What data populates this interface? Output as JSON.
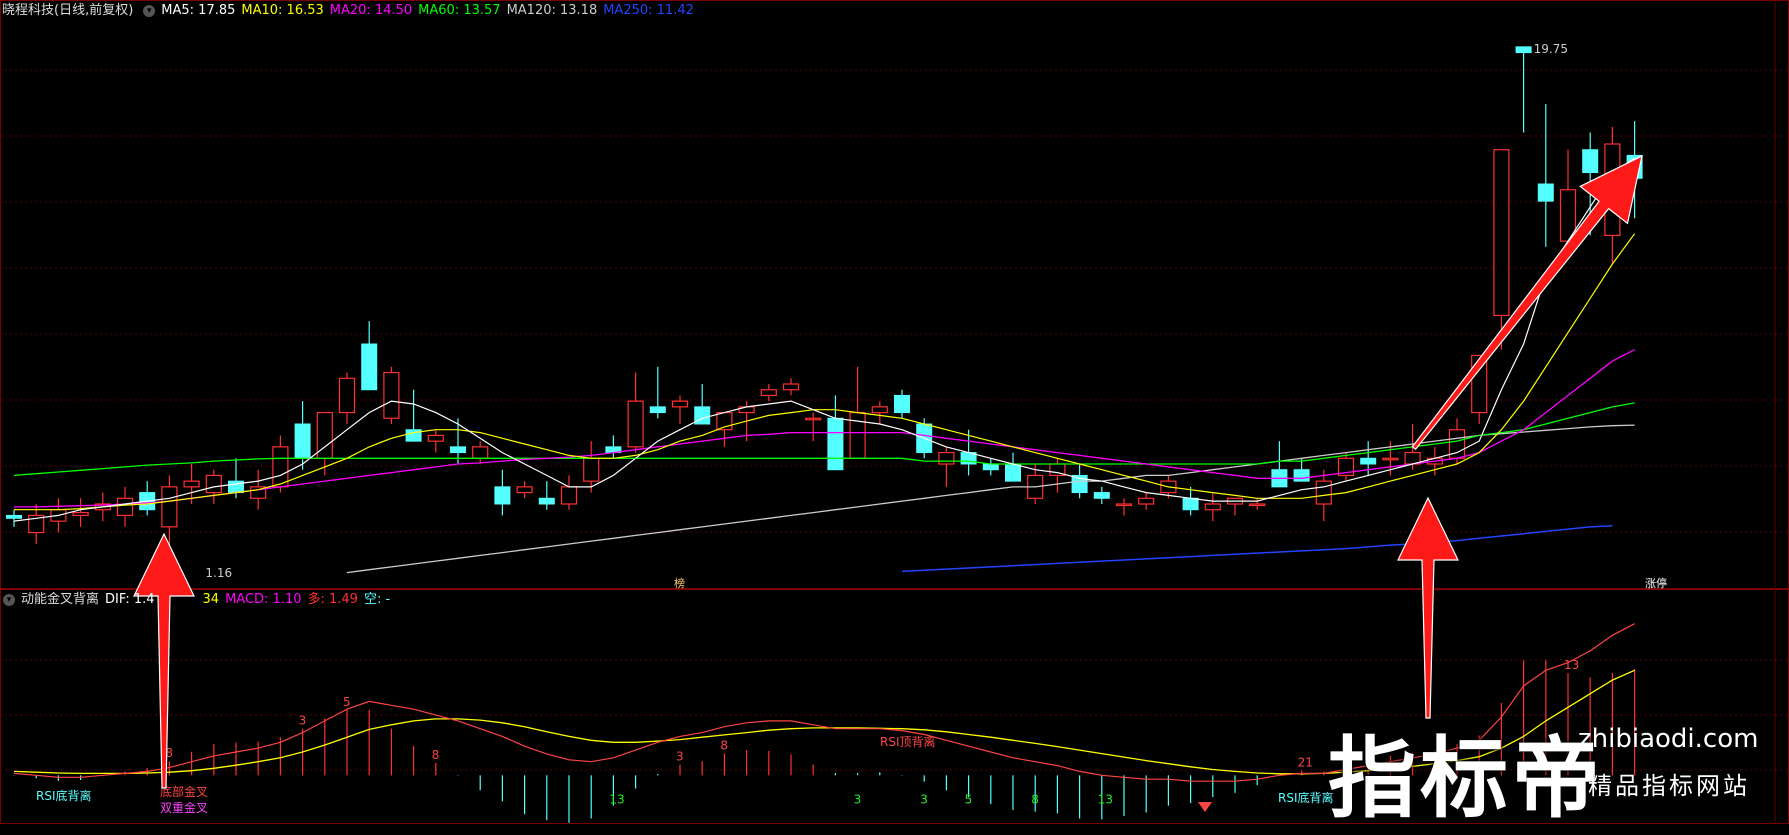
{
  "header": {
    "stock": "晓程科技(日线,前复权)",
    "ma5": "MA5: 17.85",
    "ma10": "MA10: 16.53",
    "ma20": "MA20: 14.50",
    "ma60": "MA60: 13.57",
    "ma120": "MA120: 13.18",
    "ma250": "MA250: 11.42"
  },
  "sub_header": {
    "name": "动能金叉背离",
    "dif": "DIF: 1.4",
    "dea_fragment": "34",
    "macd": "MACD: 1.10",
    "duo": "多: 1.49",
    "kong": "空: -"
  },
  "price_labels": {
    "high": "19.75",
    "low": "1.16"
  },
  "markers": {
    "bang": "榜",
    "zhangting": "涨停"
  },
  "sub_labels": {
    "rsi_bottom_1": "RSI底背离",
    "dibu_jincha": "底部金叉",
    "shuangchong_jincha": "双重金叉",
    "rsi_top": "RSI顶背离",
    "rsi_bottom_2": "RSI底背离"
  },
  "watermark": {
    "big": "指标帝",
    "url": "zhibiaodi.com",
    "sub": "精品指标网站"
  },
  "colors": {
    "ma5": "#ffffff",
    "ma10": "#ffff00",
    "ma20": "#ff00ff",
    "ma60": "#00ff00",
    "ma120": "#cccccc",
    "ma250": "#2244ff",
    "up": "#ff3030",
    "down": "#54ffff",
    "arrow": "#ff1a1a",
    "grid": "#5a0000"
  },
  "chart_data": {
    "type": "candlestick",
    "ylim": [
      10.4,
      20.2
    ],
    "ohlc": [
      [
        11.6,
        11.7,
        11.4,
        11.55
      ],
      [
        11.3,
        11.8,
        11.1,
        11.6
      ],
      [
        11.5,
        11.9,
        11.3,
        11.7
      ],
      [
        11.6,
        11.9,
        11.4,
        11.65
      ],
      [
        11.7,
        12.0,
        11.5,
        11.8
      ],
      [
        11.6,
        12.1,
        11.4,
        11.9
      ],
      [
        12.0,
        12.2,
        11.6,
        11.7
      ],
      [
        11.4,
        12.3,
        10.8,
        12.1
      ],
      [
        12.1,
        12.5,
        11.8,
        12.2
      ],
      [
        12.0,
        12.4,
        11.8,
        12.3
      ],
      [
        12.2,
        12.6,
        11.9,
        12.0
      ],
      [
        11.9,
        12.4,
        11.7,
        12.1
      ],
      [
        12.1,
        13.0,
        12.0,
        12.8
      ],
      [
        13.2,
        13.6,
        12.4,
        12.6
      ],
      [
        12.6,
        13.4,
        12.3,
        13.4
      ],
      [
        13.4,
        14.1,
        13.2,
        14.0
      ],
      [
        14.6,
        15.0,
        13.8,
        13.8
      ],
      [
        13.3,
        14.2,
        13.2,
        14.1
      ],
      [
        13.1,
        13.8,
        13.0,
        12.9
      ],
      [
        12.9,
        13.1,
        12.7,
        13.0
      ],
      [
        12.8,
        13.3,
        12.5,
        12.7
      ],
      [
        12.6,
        12.9,
        12.5,
        12.8
      ],
      [
        12.1,
        12.4,
        11.6,
        11.8
      ],
      [
        12.0,
        12.2,
        11.9,
        12.1
      ],
      [
        11.9,
        12.2,
        11.7,
        11.8
      ],
      [
        11.8,
        12.3,
        11.7,
        12.1
      ],
      [
        12.2,
        12.9,
        12.0,
        12.6
      ],
      [
        12.8,
        13.0,
        12.6,
        12.7
      ],
      [
        12.8,
        14.1,
        12.7,
        13.6
      ],
      [
        13.5,
        14.2,
        13.3,
        13.4
      ],
      [
        13.5,
        13.7,
        13.2,
        13.6
      ],
      [
        13.5,
        13.9,
        13.2,
        13.2
      ],
      [
        13.1,
        13.2,
        12.8,
        13.4
      ],
      [
        13.4,
        13.6,
        12.9,
        13.5
      ],
      [
        13.7,
        13.9,
        13.6,
        13.8
      ],
      [
        13.8,
        14.0,
        13.7,
        13.9
      ],
      [
        13.3,
        13.4,
        12.9,
        13.3
      ],
      [
        13.3,
        13.7,
        12.7,
        12.4
      ],
      [
        12.6,
        14.2,
        12.6,
        13.4
      ],
      [
        13.4,
        13.6,
        13.2,
        13.5
      ],
      [
        13.7,
        13.8,
        13.3,
        13.4
      ],
      [
        13.2,
        13.3,
        12.6,
        12.7
      ],
      [
        12.5,
        12.8,
        12.1,
        12.7
      ],
      [
        12.7,
        13.1,
        12.3,
        12.5
      ],
      [
        12.5,
        12.6,
        12.3,
        12.4
      ],
      [
        12.5,
        12.7,
        12.2,
        12.2
      ],
      [
        11.9,
        12.5,
        11.8,
        12.3
      ],
      [
        12.3,
        12.6,
        12.0,
        12.5
      ],
      [
        12.3,
        12.5,
        11.9,
        12.0
      ],
      [
        12.0,
        12.1,
        11.8,
        11.9
      ],
      [
        11.8,
        11.9,
        11.6,
        11.8
      ],
      [
        11.8,
        12.0,
        11.7,
        11.9
      ],
      [
        12.0,
        12.3,
        11.9,
        12.2
      ],
      [
        11.9,
        12.1,
        11.6,
        11.7
      ],
      [
        11.7,
        12.0,
        11.5,
        11.8
      ],
      [
        11.8,
        11.9,
        11.6,
        11.9
      ],
      [
        11.8,
        11.9,
        11.7,
        11.8
      ],
      [
        12.4,
        12.9,
        12.1,
        12.1
      ],
      [
        12.4,
        12.6,
        12.2,
        12.2
      ],
      [
        11.8,
        12.4,
        11.5,
        12.2
      ],
      [
        12.3,
        12.7,
        12.2,
        12.6
      ],
      [
        12.6,
        12.9,
        12.3,
        12.5
      ],
      [
        12.6,
        12.9,
        12.3,
        12.6
      ],
      [
        12.5,
        13.2,
        12.4,
        12.7
      ],
      [
        12.5,
        12.8,
        12.3,
        12.6
      ],
      [
        12.6,
        13.3,
        12.5,
        13.1
      ],
      [
        13.4,
        13.8,
        13.2,
        14.4
      ],
      [
        15.1,
        16.2,
        14.5,
        18.0
      ],
      [
        19.8,
        19.8,
        18.3,
        19.7
      ],
      [
        17.4,
        18.8,
        16.3,
        17.1
      ],
      [
        16.4,
        18.0,
        16.1,
        17.3
      ],
      [
        18.0,
        18.3,
        16.5,
        17.6
      ],
      [
        16.5,
        18.4,
        16.0,
        18.1
      ],
      [
        17.9,
        18.5,
        16.8,
        17.5
      ]
    ],
    "ma5": [
      11.5,
      11.55,
      11.6,
      11.7,
      11.75,
      11.8,
      11.85,
      11.9,
      12.0,
      12.1,
      12.15,
      12.2,
      12.3,
      12.5,
      12.8,
      13.1,
      13.4,
      13.6,
      13.55,
      13.4,
      13.2,
      12.95,
      12.7,
      12.5,
      12.3,
      12.1,
      12.1,
      12.3,
      12.6,
      12.9,
      13.1,
      13.3,
      13.4,
      13.5,
      13.55,
      13.6,
      13.45,
      13.3,
      13.25,
      13.2,
      13.1,
      12.95,
      12.8,
      12.7,
      12.6,
      12.5,
      12.4,
      12.35,
      12.25,
      12.2,
      12.1,
      12.0,
      11.95,
      11.9,
      11.85,
      11.85,
      11.85,
      11.95,
      12.05,
      12.1,
      12.2,
      12.3,
      12.4,
      12.5,
      12.6,
      12.7,
      12.9,
      13.8,
      14.6,
      15.8,
      16.4,
      17.0,
      17.6,
      17.85
    ],
    "ma10": [
      11.7,
      11.7,
      11.7,
      11.72,
      11.75,
      11.78,
      11.8,
      11.85,
      11.9,
      11.95,
      12.0,
      12.05,
      12.15,
      12.3,
      12.45,
      12.6,
      12.8,
      12.95,
      13.05,
      13.1,
      13.1,
      13.05,
      12.95,
      12.85,
      12.75,
      12.65,
      12.6,
      12.6,
      12.65,
      12.75,
      12.9,
      13.0,
      13.15,
      13.25,
      13.35,
      13.4,
      13.45,
      13.45,
      13.4,
      13.35,
      13.3,
      13.2,
      13.1,
      13.0,
      12.9,
      12.8,
      12.7,
      12.6,
      12.5,
      12.4,
      12.3,
      12.2,
      12.1,
      12.05,
      12.0,
      11.95,
      11.9,
      11.9,
      11.9,
      11.95,
      12.0,
      12.1,
      12.2,
      12.3,
      12.4,
      12.5,
      12.7,
      13.1,
      13.6,
      14.2,
      14.8,
      15.4,
      16.0,
      16.53
    ],
    "ma20": [
      11.75,
      11.75,
      11.76,
      11.77,
      11.78,
      11.8,
      11.82,
      11.85,
      11.9,
      11.95,
      12.0,
      12.05,
      12.1,
      12.15,
      12.2,
      12.25,
      12.3,
      12.35,
      12.4,
      12.45,
      12.5,
      12.52,
      12.55,
      12.58,
      12.6,
      12.62,
      12.65,
      12.7,
      12.75,
      12.8,
      12.85,
      12.9,
      12.95,
      13.0,
      13.02,
      13.05,
      13.05,
      13.05,
      13.05,
      13.05,
      13.05,
      13.0,
      12.95,
      12.9,
      12.85,
      12.8,
      12.75,
      12.7,
      12.65,
      12.6,
      12.55,
      12.5,
      12.45,
      12.4,
      12.35,
      12.3,
      12.25,
      12.25,
      12.25,
      12.3,
      12.35,
      12.4,
      12.45,
      12.5,
      12.55,
      12.6,
      12.7,
      12.9,
      13.1,
      13.4,
      13.7,
      14.0,
      14.3,
      14.5
    ],
    "ma60": [
      12.3,
      12.33,
      12.36,
      12.39,
      12.42,
      12.45,
      12.48,
      12.5,
      12.52,
      12.55,
      12.57,
      12.59,
      12.6,
      12.6,
      12.6,
      12.6,
      12.6,
      12.6,
      12.6,
      12.6,
      12.6,
      12.6,
      12.6,
      12.6,
      12.6,
      12.6,
      12.6,
      12.6,
      12.6,
      12.6,
      12.6,
      12.6,
      12.6,
      12.6,
      12.6,
      12.6,
      12.6,
      12.6,
      12.6,
      12.6,
      12.6,
      12.55,
      12.55,
      12.55,
      12.5,
      12.5,
      12.5,
      12.5,
      12.5,
      12.5,
      12.5,
      12.5,
      12.5,
      12.5,
      12.5,
      12.5,
      12.5,
      12.55,
      12.55,
      12.6,
      12.65,
      12.7,
      12.75,
      12.8,
      12.85,
      12.9,
      13.0,
      13.05,
      13.1,
      13.2,
      13.3,
      13.4,
      13.5,
      13.57
    ],
    "ma120": [
      null,
      null,
      null,
      null,
      null,
      null,
      null,
      null,
      null,
      null,
      null,
      null,
      null,
      null,
      null,
      10.6,
      10.65,
      10.7,
      10.75,
      10.8,
      10.85,
      10.9,
      10.95,
      11.0,
      11.05,
      11.1,
      11.15,
      11.2,
      11.25,
      11.3,
      11.35,
      11.4,
      11.45,
      11.5,
      11.55,
      11.6,
      11.65,
      11.7,
      11.75,
      11.8,
      11.85,
      11.9,
      11.95,
      12.0,
      12.05,
      12.1,
      12.1,
      12.15,
      12.2,
      12.2,
      12.25,
      12.3,
      12.3,
      12.35,
      12.4,
      12.45,
      12.5,
      12.55,
      12.6,
      12.65,
      12.7,
      12.75,
      12.8,
      12.85,
      12.9,
      12.95,
      13.0,
      13.03,
      13.06,
      13.09,
      13.12,
      13.15,
      13.17,
      13.18
    ],
    "ma250": [
      null,
      null,
      null,
      null,
      null,
      null,
      null,
      null,
      null,
      null,
      null,
      null,
      null,
      null,
      null,
      null,
      null,
      null,
      null,
      null,
      null,
      null,
      null,
      null,
      null,
      null,
      null,
      null,
      null,
      null,
      null,
      null,
      null,
      null,
      null,
      null,
      null,
      null,
      null,
      null,
      10.62,
      10.64,
      10.66,
      10.68,
      10.7,
      10.72,
      10.74,
      10.76,
      10.78,
      10.8,
      10.82,
      10.84,
      10.86,
      10.88,
      10.9,
      10.92,
      10.94,
      10.96,
      10.98,
      11.0,
      11.02,
      11.05,
      11.08,
      11.1,
      11.13,
      11.16,
      11.2,
      11.24,
      11.28,
      11.32,
      11.36,
      11.4,
      11.42
    ],
    "macd_ylim": [
      -1.2,
      4.2
    ],
    "dif": [
      0.05,
      0.0,
      -0.05,
      -0.05,
      0.0,
      0.05,
      0.1,
      0.2,
      0.35,
      0.5,
      0.6,
      0.7,
      0.85,
      1.1,
      1.4,
      1.7,
      1.9,
      1.8,
      1.7,
      1.55,
      1.4,
      1.2,
      1.0,
      0.75,
      0.55,
      0.4,
      0.35,
      0.45,
      0.65,
      0.85,
      1.0,
      1.1,
      1.25,
      1.35,
      1.4,
      1.4,
      1.3,
      1.2,
      1.2,
      1.2,
      1.15,
      1.05,
      0.9,
      0.75,
      0.6,
      0.45,
      0.35,
      0.25,
      0.1,
      0.0,
      -0.05,
      -0.1,
      -0.1,
      -0.15,
      -0.15,
      -0.15,
      -0.1,
      0.0,
      0.05,
      0.05,
      0.15,
      0.25,
      0.35,
      0.45,
      0.55,
      0.7,
      0.9,
      1.5,
      2.3,
      2.7,
      2.9,
      3.2,
      3.6,
      3.9
    ],
    "dea": [
      0.1,
      0.08,
      0.06,
      0.05,
      0.05,
      0.05,
      0.06,
      0.08,
      0.12,
      0.18,
      0.26,
      0.35,
      0.45,
      0.6,
      0.78,
      0.98,
      1.18,
      1.3,
      1.4,
      1.45,
      1.45,
      1.42,
      1.35,
      1.25,
      1.12,
      1.0,
      0.9,
      0.85,
      0.85,
      0.88,
      0.92,
      0.98,
      1.04,
      1.1,
      1.16,
      1.2,
      1.22,
      1.22,
      1.22,
      1.21,
      1.2,
      1.17,
      1.12,
      1.05,
      0.98,
      0.9,
      0.82,
      0.74,
      0.65,
      0.56,
      0.47,
      0.38,
      0.3,
      0.22,
      0.15,
      0.1,
      0.06,
      0.04,
      0.04,
      0.05,
      0.08,
      0.12,
      0.17,
      0.23,
      0.3,
      0.38,
      0.48,
      0.7,
      1.0,
      1.4,
      1.75,
      2.1,
      2.45,
      2.7
    ],
    "bar_counts": [
      {
        "i": 7,
        "label": "8"
      },
      {
        "i": 13,
        "label": "3"
      },
      {
        "i": 15,
        "label": "5"
      },
      {
        "i": 19,
        "label": "8"
      },
      {
        "i": 27,
        "label": "13"
      },
      {
        "i": 30,
        "label": "3"
      },
      {
        "i": 32,
        "label": "8"
      },
      {
        "i": 38,
        "label": "3"
      },
      {
        "i": 41,
        "label": "3"
      },
      {
        "i": 43,
        "label": "5"
      },
      {
        "i": 46,
        "label": "8"
      },
      {
        "i": 49,
        "label": "13"
      },
      {
        "i": 58,
        "label": "21"
      },
      {
        "i": 70,
        "label": "13"
      }
    ]
  }
}
